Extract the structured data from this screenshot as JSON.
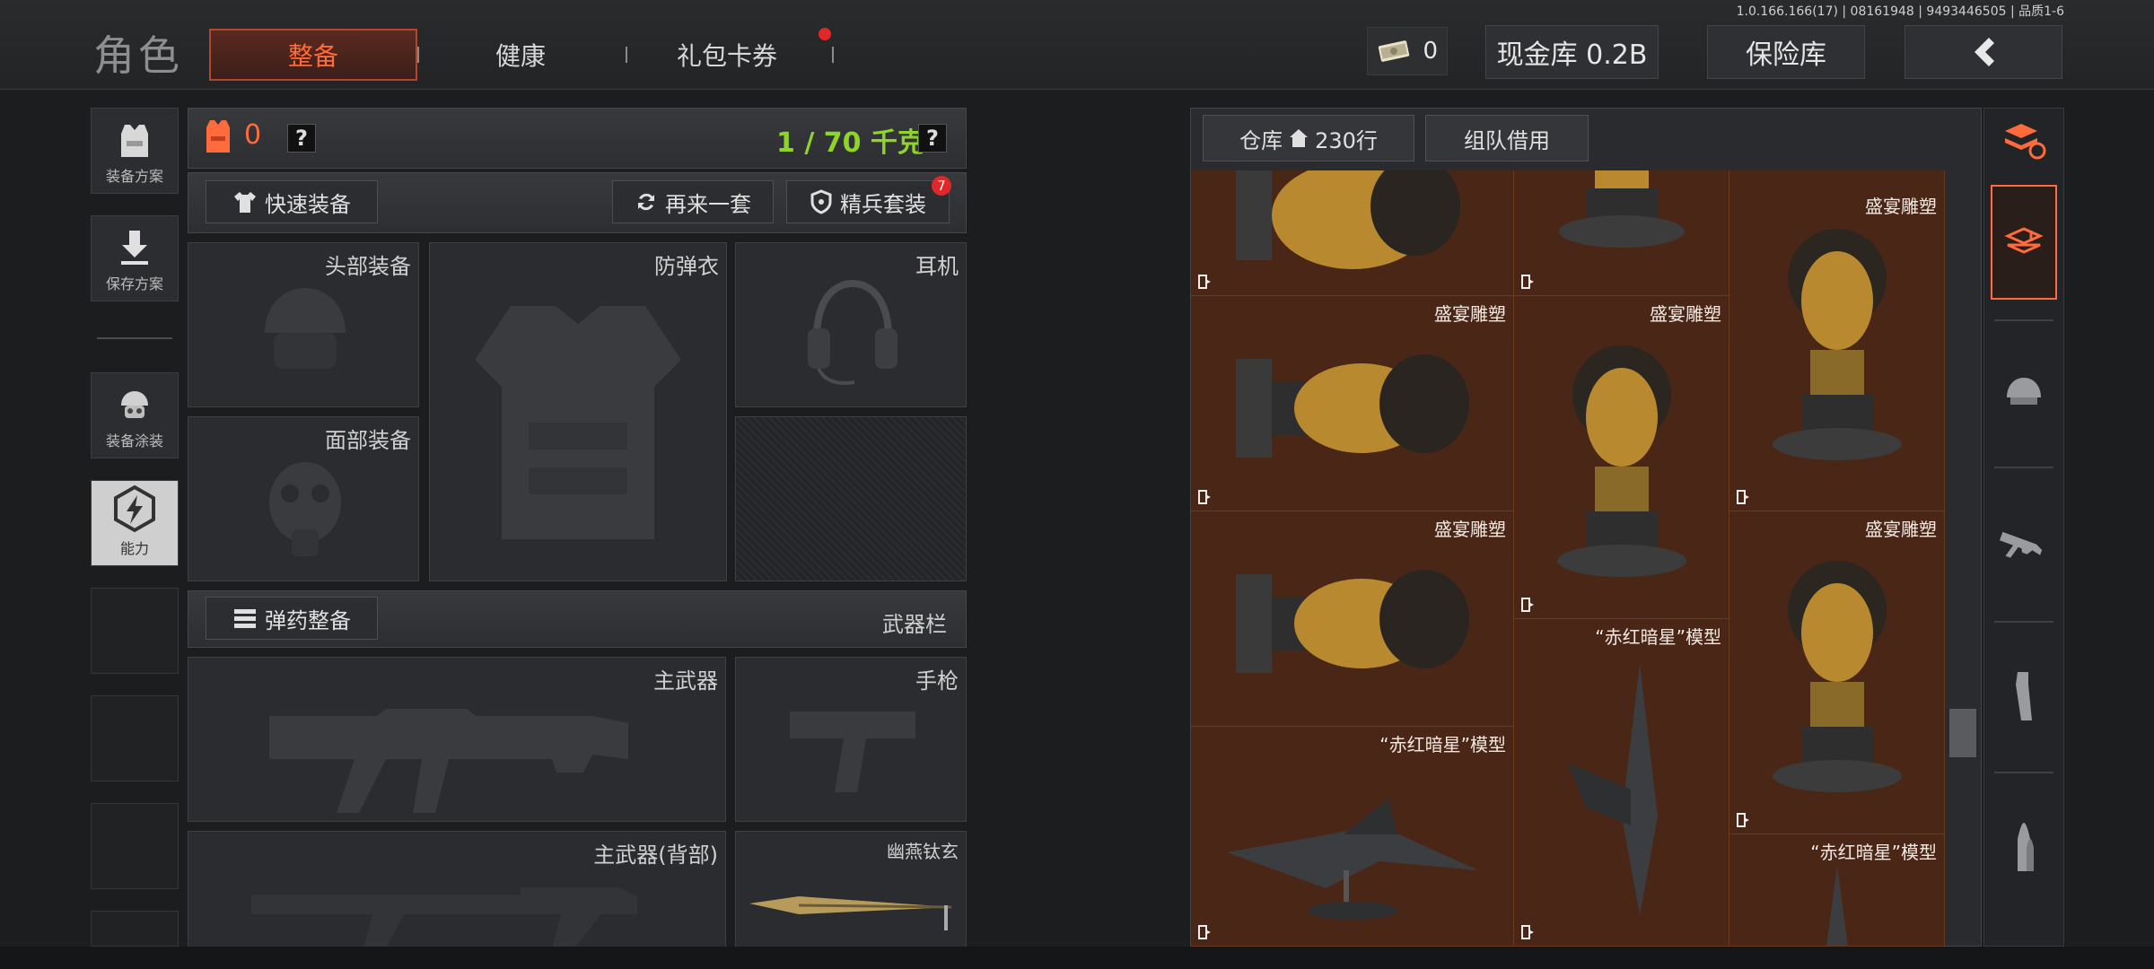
{
  "version_text": "1.0.166.166(17) | 08161948 | 9493446505 | 品质1-6",
  "header": {
    "title": "角色",
    "tabs": [
      {
        "label": "整备",
        "active": true
      },
      {
        "label": "健康",
        "active": false
      },
      {
        "label": "礼包卡券",
        "active": false,
        "badge_dot": true
      }
    ],
    "cash_count": "0",
    "vault_label": "现金库 0.2B",
    "insurance_label": "保险库",
    "back_icon": "chevron-left-icon"
  },
  "left_rail": [
    {
      "label": "装备方案",
      "icon": "vest-icon"
    },
    {
      "label": "保存方案",
      "icon": "download-icon"
    },
    {
      "label": "装备涂装",
      "icon": "helmet-skin-icon"
    },
    {
      "label": "能力",
      "icon": "lightning-hex-icon",
      "active": true
    }
  ],
  "equipment": {
    "armor_count": "0",
    "help": "?",
    "weight": "1 / 70 千克",
    "quick_equip": "快速装备",
    "again_set": "再来一套",
    "elite_set": "精兵套装",
    "elite_badge": "7",
    "slots": {
      "head": "头部装备",
      "body": "防弹衣",
      "earphone": "耳机",
      "face": "面部装备"
    },
    "ammo_equip": "弹药整备",
    "weapon_bar": "武器栏",
    "weapon_slots": {
      "primary": "主武器",
      "pistol": "手枪",
      "primary_back": "主武器(背部)",
      "melee": "幽燕钛玄"
    }
  },
  "warehouse": {
    "tab_label": "仓库",
    "tab_rows": "230行",
    "team_borrow": "组队借用",
    "items": [
      {
        "label": "",
        "kind": "bust-side"
      },
      {
        "label": "",
        "kind": "bust-top"
      },
      {
        "label": "盛宴雕塑",
        "kind": "bust"
      },
      {
        "label": "盛宴雕塑",
        "kind": "bust-side"
      },
      {
        "label": "盛宴雕塑",
        "kind": "bust"
      },
      {
        "label": "盛宴雕塑",
        "kind": "bust-side"
      },
      {
        "label": "盛宴雕塑",
        "kind": "bust"
      },
      {
        "label": "“赤红暗星”模型",
        "kind": "jet-side"
      },
      {
        "label": "“赤红暗星”模型",
        "kind": "jet-vertical"
      },
      {
        "label": "“赤红暗星”模型",
        "kind": "jet-tip"
      }
    ]
  },
  "colors": {
    "accent": "#ff6b3a",
    "weight_green": "#8fd42a",
    "warehouse_bg": "#4a2617"
  }
}
